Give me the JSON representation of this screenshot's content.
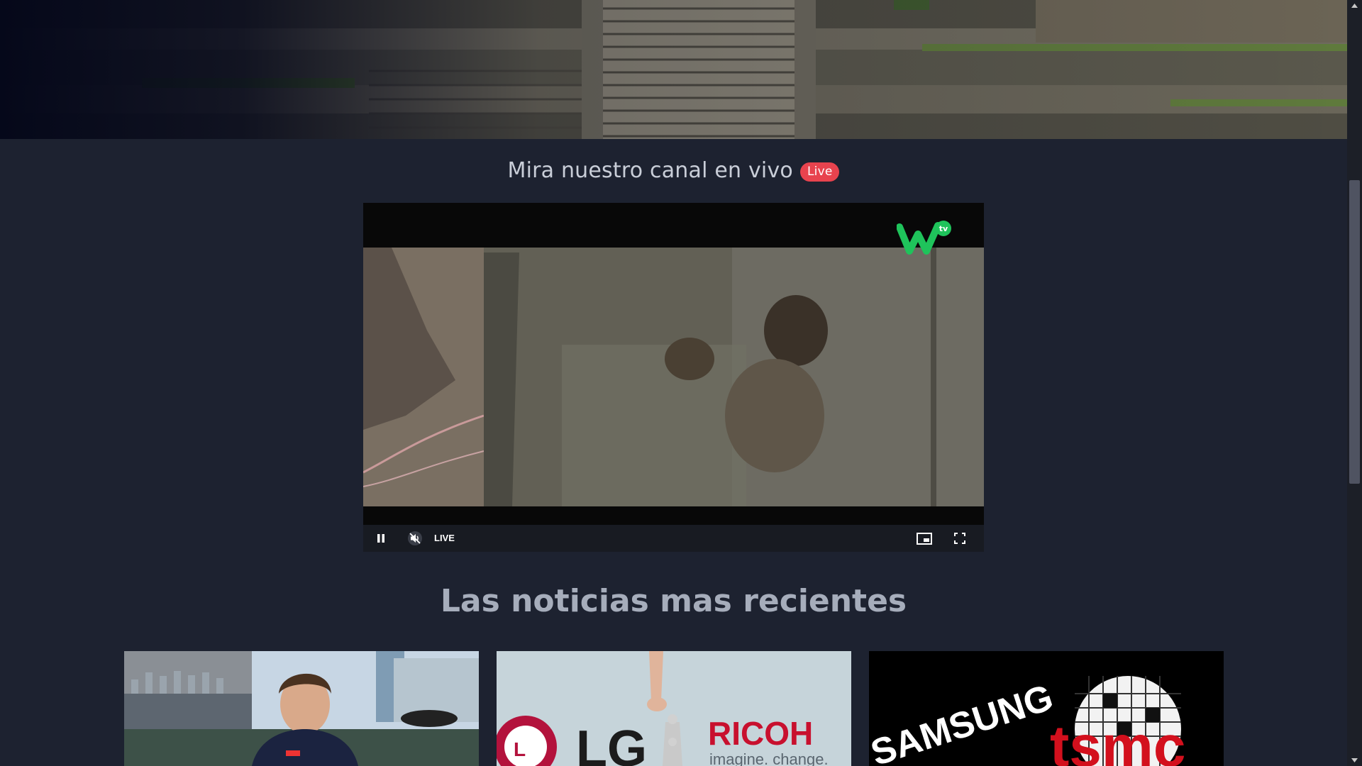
{
  "live_section": {
    "title": "Mira nuestro canal en vivo",
    "badge": "Live"
  },
  "player": {
    "channel_logo": "W tv",
    "live_label": "LIVE",
    "controls": {
      "pause": "pause-icon",
      "mute": "muted-speaker-icon",
      "pip": "picture-in-picture-icon",
      "fullscreen": "fullscreen-icon"
    }
  },
  "news": {
    "heading": "Las noticias mas recientes",
    "cards": [
      {
        "image": "formula-1-driver-photo"
      },
      {
        "image": "lg-ricoh-puzzle-photo",
        "logo_left": "LG",
        "logo_right": "RICOH",
        "tagline": "imagine. change."
      },
      {
        "image": "samsung-tsmc-photo",
        "logo_left": "SAMSUNG",
        "logo_right": "tsmc"
      }
    ]
  },
  "colors": {
    "background": "#1d2230",
    "badge": "#e8434e",
    "logo_green": "#1fc35b"
  }
}
